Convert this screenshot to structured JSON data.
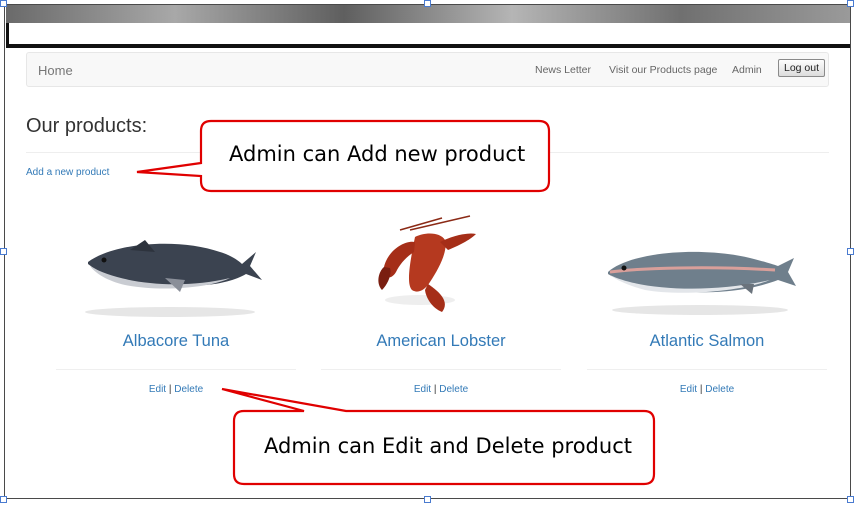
{
  "navbar": {
    "brand": "Home",
    "links": [
      "News Letter",
      "Visit our Products page",
      "Admin"
    ],
    "logout_label": "Log out"
  },
  "page": {
    "title": "Our products:",
    "add_link": "Add a new product"
  },
  "products": [
    {
      "name": "Albacore Tuna",
      "edit_label": "Edit",
      "separator": "|",
      "delete_label": "Delete",
      "image_icon": "tuna-fish"
    },
    {
      "name": "American Lobster",
      "edit_label": "Edit",
      "separator": "|",
      "delete_label": "Delete",
      "image_icon": "lobster"
    },
    {
      "name": "Atlantic Salmon",
      "edit_label": "Edit",
      "separator": "|",
      "delete_label": "Delete",
      "image_icon": "salmon-fish"
    }
  ],
  "callouts": [
    {
      "text": "Admin can Add new product"
    },
    {
      "text": "Admin can Edit and Delete product"
    }
  ],
  "colors": {
    "link": "#337ab7",
    "callout_border": "#e00000"
  }
}
